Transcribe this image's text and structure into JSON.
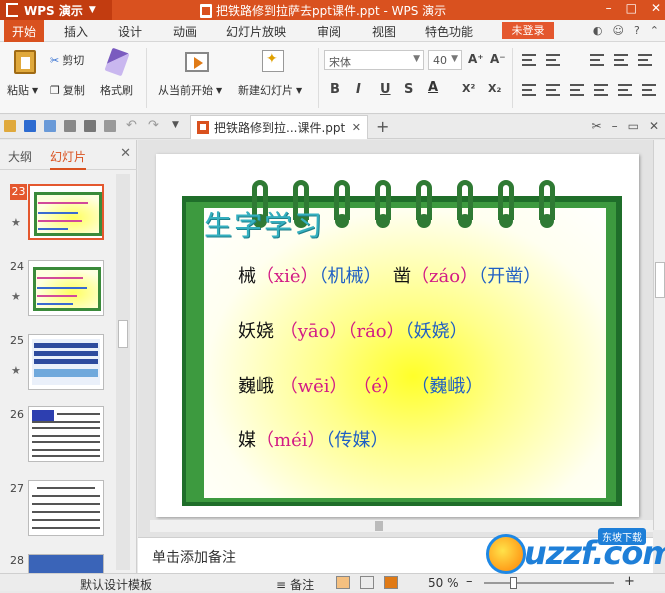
{
  "titlebar": {
    "app_name": "WPS 演示",
    "document_title": "把铁路修到拉萨去ppt课件.ppt - WPS 演示"
  },
  "menu": {
    "tabs": [
      "开始",
      "插入",
      "设计",
      "动画",
      "幻灯片放映",
      "审阅",
      "视图",
      "特色功能"
    ],
    "active_tab": "开始",
    "login_label": "未登录"
  },
  "ribbon": {
    "paste": "粘贴",
    "cut": "剪切",
    "copy": "复制",
    "format_painter": "格式刷",
    "from_current": "从当前开始",
    "new_slide": "新建幻灯片",
    "font_name": "宋体",
    "font_size": "40"
  },
  "doc_tab": {
    "label": "把铁路修到拉...课件.ppt"
  },
  "left_panel": {
    "tab_outline": "大纲",
    "tab_slides": "幻灯片",
    "active_tab": "幻灯片",
    "slides": [
      {
        "number": "23",
        "selected": true
      },
      {
        "number": "24",
        "selected": false
      },
      {
        "number": "25",
        "selected": false
      },
      {
        "number": "26",
        "selected": false
      },
      {
        "number": "27",
        "selected": false
      },
      {
        "number": "28",
        "selected": false
      }
    ]
  },
  "slide": {
    "heading": "生字学习",
    "lines": [
      {
        "parts": [
          {
            "t": "械",
            "c": "b"
          },
          {
            "t": "（xiè）",
            "c": "p"
          },
          {
            "t": "（机械）",
            "c": "w"
          },
          {
            "t": "  凿",
            "c": "b"
          },
          {
            "t": "（záo）",
            "c": "p"
          },
          {
            "t": "（开凿）",
            "c": "w"
          }
        ]
      },
      {
        "parts": [
          {
            "t": "妖娆",
            "c": "b"
          },
          {
            "t": " （yāo）（ráo）",
            "c": "p"
          },
          {
            "t": "（妖娆）",
            "c": "w"
          }
        ]
      },
      {
        "parts": [
          {
            "t": "巍峨",
            "c": "b"
          },
          {
            "t": " （wēi） （é） ",
            "c": "p"
          },
          {
            "t": " （巍峨）",
            "c": "w"
          }
        ]
      },
      {
        "parts": [
          {
            "t": "媒",
            "c": "b"
          },
          {
            "t": "（méi）",
            "c": "p"
          },
          {
            "t": "（传媒）",
            "c": "w"
          }
        ]
      }
    ]
  },
  "notes": {
    "placeholder": "单击添加备注"
  },
  "statusbar": {
    "template": "默认设计模板",
    "notes_label": "备注",
    "zoom": "50 %"
  },
  "watermark": {
    "text": "uzzf.com",
    "tag": "东坡下载"
  },
  "colors": {
    "accent": "#d9511f",
    "calendar_green": "#3d9a3f",
    "pinyin": "#d21a85",
    "word": "#1f5fc4",
    "heading": "#35b0c0"
  }
}
